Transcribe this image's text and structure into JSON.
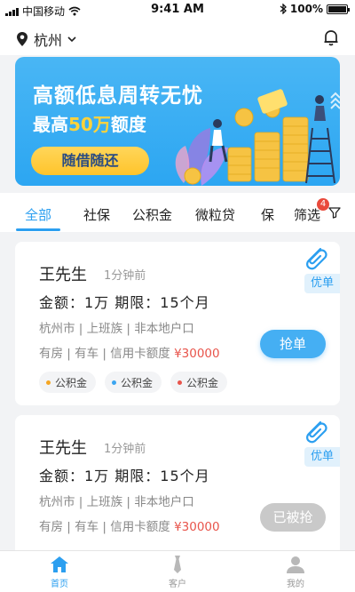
{
  "status_bar": {
    "carrier": "中国移动",
    "time": "9:41 AM",
    "battery": "100%"
  },
  "header": {
    "city": "杭州"
  },
  "banner": {
    "title": "高额低息周转无忧",
    "subtitle_prefix": "最高",
    "subtitle_highlight": "50万",
    "subtitle_suffix": "额度",
    "button_label": "随借随还"
  },
  "tabs": {
    "items": [
      "全部",
      "社保",
      "公积金",
      "微粒贷",
      "保"
    ],
    "active_index": 0,
    "filter_label": "筛选",
    "filter_badge": "4"
  },
  "cards": [
    {
      "name": "王先生",
      "time": "1分钟前",
      "amount_line": "金额：1万   期限：15个月",
      "info_line": "杭州市 | 上班族 | 非本地户口",
      "info2_prefix": "有房 | 有车 | 信用卡额度 ",
      "info2_money": "¥30000",
      "badge": "优单",
      "action_label": "抢单",
      "tags": [
        {
          "label": "公积金",
          "color": "#f5a623"
        },
        {
          "label": "公积金",
          "color": "#3ba5f0"
        },
        {
          "label": "公积金",
          "color": "#e8544b"
        }
      ]
    },
    {
      "name": "王先生",
      "time": "1分钟前",
      "amount_line": "金额：1万   期限：15个月",
      "info_line": "杭州市 | 上班族 | 非本地户口",
      "info2_prefix": "有房 | 有车 | 信用卡额度 ",
      "info2_money": "¥30000",
      "badge": "优单",
      "action_label": "已被抢"
    }
  ],
  "bottom_nav": {
    "home": "首页",
    "customers": "客户",
    "mine": "我的"
  },
  "colors": {
    "accent": "#2c9ff0",
    "money": "#e8544b",
    "banner_button": "#ffc42b"
  }
}
